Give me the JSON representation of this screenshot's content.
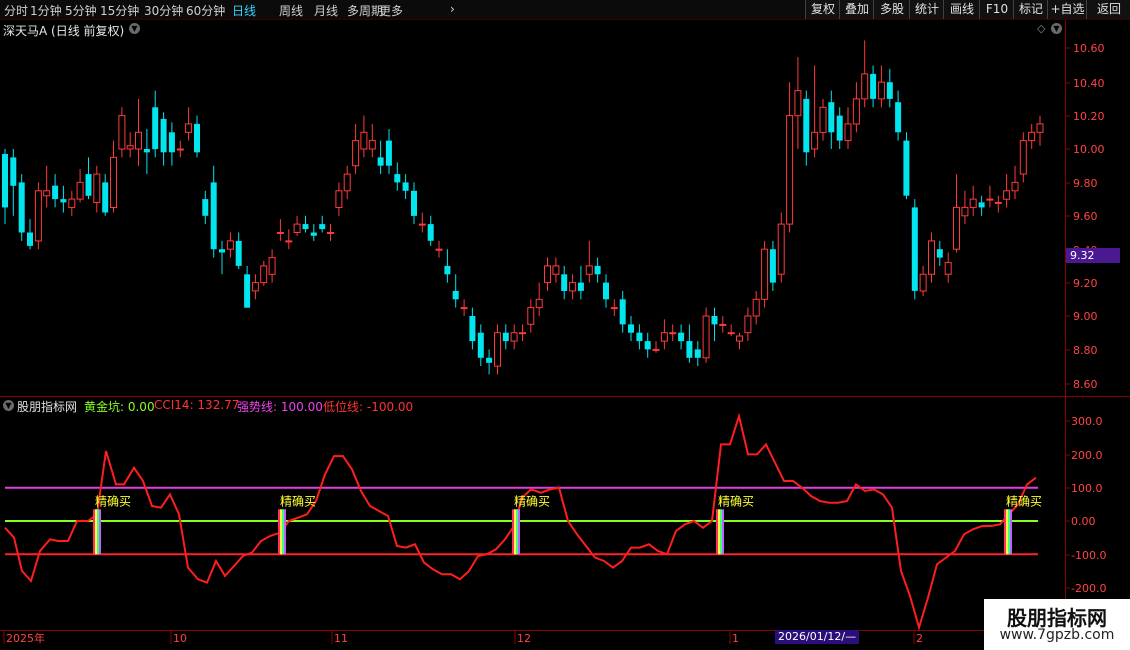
{
  "periods": [
    "分时",
    "1分钟",
    "5分钟",
    "15分钟",
    "30分钟",
    "60分钟",
    "日线",
    "周线",
    "月线",
    "多周期",
    "更多"
  ],
  "active_period": "日线",
  "toolbar": [
    "复权",
    "叠加",
    "多股",
    "统计",
    "画线",
    "F10",
    "标记",
    "+自选",
    "返回"
  ],
  "stock_title": "深天马A (日线 前复权)",
  "price_axis": [
    "10.60",
    "10.40",
    "10.20",
    "10.00",
    "9.80",
    "9.60",
    "9.40",
    "9.32",
    "9.20",
    "9.00",
    "8.80",
    "8.60"
  ],
  "current_price": "9.32",
  "indicator": {
    "name": "股朋指标网",
    "huangjinkeng": "黄金坑: 0.00",
    "cci": "CCI14: 132.77",
    "qiangshixian": "强势线: 100.00",
    "diweixian": "低位线: -100.00",
    "axis": [
      "300.0",
      "200.0",
      "100.0",
      "0.00",
      "-100.0",
      "-200.0"
    ],
    "signal_label": "精确买"
  },
  "date_axis": [
    "2025年",
    "10",
    "11",
    "12",
    "1",
    "2"
  ],
  "cursor_date": "2026/01/12/—",
  "watermark": {
    "line1": "股朋指标网",
    "line2": "www.7gpzb.com"
  },
  "colors": {
    "up": "#ff3a3a",
    "down": "#00e5ee",
    "strong_line": "#e040e0",
    "zero_line": "#88ff22",
    "low_line": "#ff2222"
  }
}
